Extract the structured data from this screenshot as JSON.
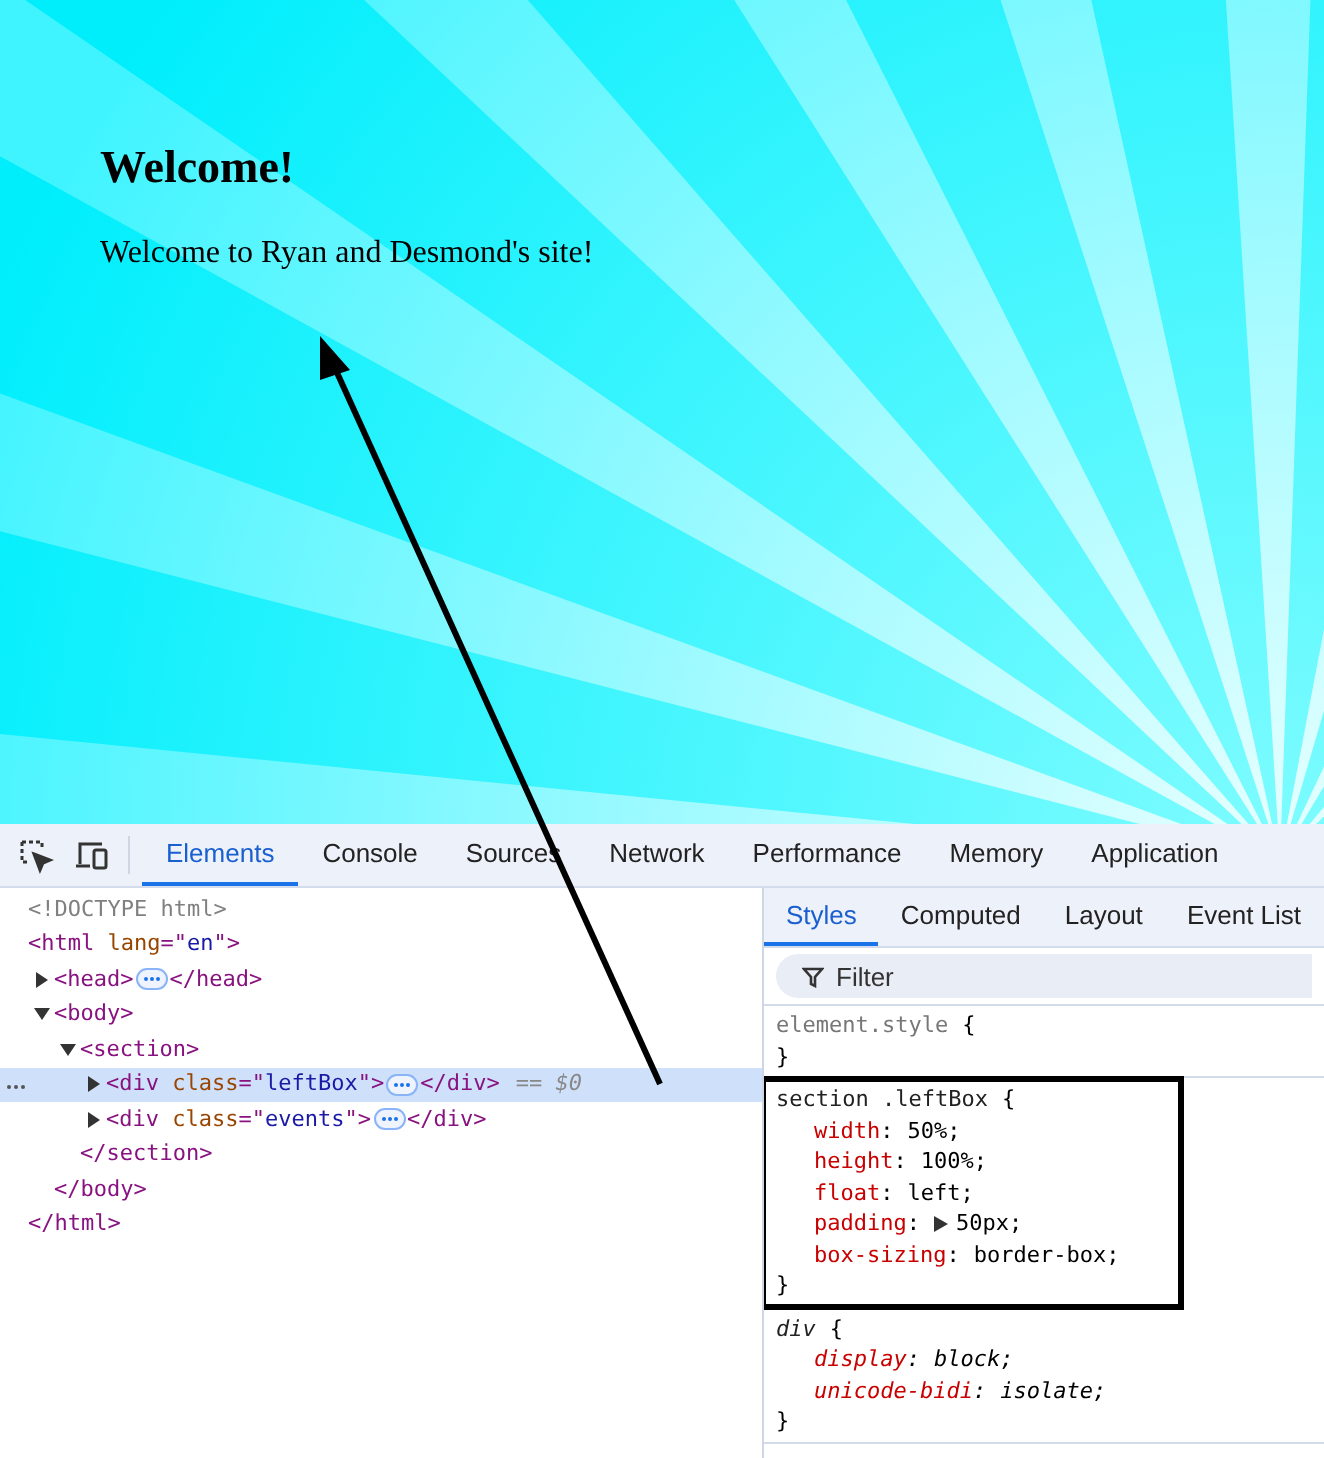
{
  "page": {
    "heading": "Welcome!",
    "paragraph": "Welcome to Ryan and Desmond's site!"
  },
  "devtools": {
    "tabs": [
      {
        "label": "Elements",
        "selected": true
      },
      {
        "label": "Console",
        "selected": false
      },
      {
        "label": "Sources",
        "selected": false
      },
      {
        "label": "Network",
        "selected": false
      },
      {
        "label": "Performance",
        "selected": false
      },
      {
        "label": "Memory",
        "selected": false
      },
      {
        "label": "Application",
        "selected": false
      }
    ],
    "dom_tree": [
      {
        "open": [
          {
            "kind": "doctype",
            "text": "<!DOCTYPE html>"
          }
        ],
        "selected": false
      },
      {
        "open": [
          {
            "kind": "tag",
            "text": "<html"
          },
          {
            "kind": "attr",
            "text": " lang"
          },
          {
            "kind": "tag",
            "text": "=\""
          },
          {
            "kind": "value",
            "text": "en"
          },
          {
            "kind": "tag",
            "text": "\">"
          }
        ],
        "close": [
          {
            "kind": "tag",
            "text": "</html>"
          }
        ],
        "selected": false,
        "children": [
          {
            "open": [
              {
                "kind": "tag",
                "text": "<head>"
              }
            ],
            "close": [
              {
                "kind": "tag",
                "text": "</head>"
              }
            ],
            "expanded": false,
            "selected": false
          },
          {
            "open": [
              {
                "kind": "tag",
                "text": "<body>"
              }
            ],
            "close": [
              {
                "kind": "tag",
                "text": "</body>"
              }
            ],
            "expanded": true,
            "selected": false,
            "children": [
              {
                "open": [
                  {
                    "kind": "tag",
                    "text": "<section>"
                  }
                ],
                "close": [
                  {
                    "kind": "tag",
                    "text": "</section>"
                  }
                ],
                "expanded": true,
                "selected": false,
                "children": [
                  {
                    "open": [
                      {
                        "kind": "tag",
                        "text": "<div"
                      },
                      {
                        "kind": "attr",
                        "text": " class"
                      },
                      {
                        "kind": "tag",
                        "text": "=\""
                      },
                      {
                        "kind": "value",
                        "text": "leftBox"
                      },
                      {
                        "kind": "tag",
                        "text": "\">"
                      }
                    ],
                    "close": [
                      {
                        "kind": "tag",
                        "text": "</div>"
                      }
                    ],
                    "expanded": false,
                    "selected": true,
                    "suffix": "== $0"
                  },
                  {
                    "open": [
                      {
                        "kind": "tag",
                        "text": "<div"
                      },
                      {
                        "kind": "attr",
                        "text": " class"
                      },
                      {
                        "kind": "tag",
                        "text": "=\""
                      },
                      {
                        "kind": "value",
                        "text": "events"
                      },
                      {
                        "kind": "tag",
                        "text": "\">"
                      }
                    ],
                    "close": [
                      {
                        "kind": "tag",
                        "text": "</div>"
                      }
                    ],
                    "expanded": false,
                    "selected": false
                  }
                ]
              }
            ]
          }
        ]
      }
    ],
    "side_tabs": [
      {
        "label": "Styles",
        "selected": true
      },
      {
        "label": "Computed",
        "selected": false
      },
      {
        "label": "Layout",
        "selected": false
      },
      {
        "label": "Event List",
        "selected": false
      }
    ],
    "filter": {
      "placeholder": "Filter"
    },
    "rules": [
      {
        "kind": "inline",
        "selector": "element.style",
        "open": "{",
        "close": "}",
        "highlighted": false
      },
      {
        "kind": "author",
        "selector": "section .leftBox",
        "open": "{",
        "close": "}",
        "highlighted": true,
        "declarations": [
          {
            "property": "width",
            "colon": ":",
            "value": "50%;",
            "expandable": false
          },
          {
            "property": "height",
            "colon": ":",
            "value": "100%;",
            "expandable": false
          },
          {
            "property": "float",
            "colon": ":",
            "value": "left;",
            "expandable": false
          },
          {
            "property": "padding",
            "colon": ":",
            "value": "50px;",
            "expandable": true
          },
          {
            "property": "box-sizing",
            "colon": ":",
            "value": "border-box;",
            "expandable": false
          }
        ]
      },
      {
        "kind": "user_agent",
        "selector": "div",
        "open": "{",
        "close": "}",
        "highlighted": false,
        "declarations": [
          {
            "property": "display",
            "colon": ":",
            "value": "block;",
            "expandable": false
          },
          {
            "property": "unicode-bidi",
            "colon": ":",
            "value": "isolate;",
            "expandable": false
          }
        ]
      }
    ]
  }
}
